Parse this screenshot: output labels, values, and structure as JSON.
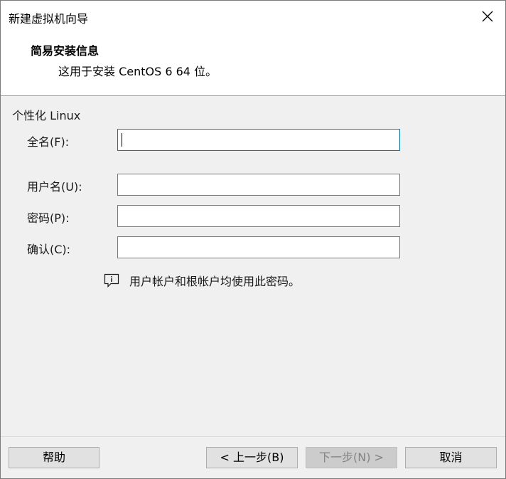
{
  "window": {
    "title": "新建虚拟机向导"
  },
  "header": {
    "title": "简易安装信息",
    "subtitle": "这用于安装 CentOS 6 64 位。"
  },
  "form": {
    "group_title": "个性化 Linux",
    "fields": [
      {
        "label": "全名(F):",
        "value": "",
        "focused": true
      },
      {
        "label": "用户名(U):",
        "value": ""
      },
      {
        "label": "密码(P):",
        "value": ""
      },
      {
        "label": "确认(C):",
        "value": ""
      }
    ],
    "info_icon": "info-speech-bubble-icon",
    "info_text": "用户帐户和根帐户均使用此密码。"
  },
  "buttons": {
    "help": "帮助",
    "back": "< 上一步(B)",
    "next": "下一步(N) >",
    "cancel": "取消"
  },
  "colors": {
    "focus_border": "#0078d7",
    "dialog_bg": "#f0f0f0",
    "disabled_text": "#838383"
  }
}
